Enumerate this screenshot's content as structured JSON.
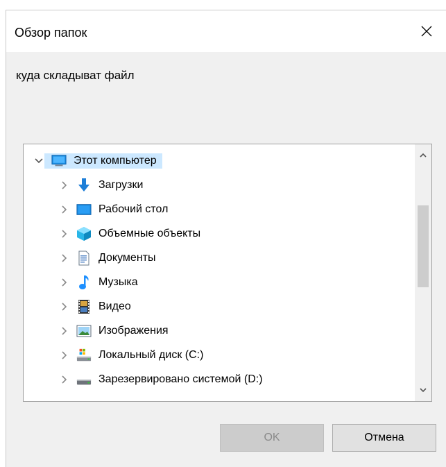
{
  "window": {
    "title": "Обзор папок"
  },
  "prompt": "куда складыват файл",
  "tree": {
    "root": {
      "label": "Этот компьютер",
      "icon": "computer-icon",
      "expanded": true,
      "selected": true
    },
    "items": [
      {
        "label": "Загрузки",
        "icon": "downloads-icon"
      },
      {
        "label": "Рабочий стол",
        "icon": "desktop-icon"
      },
      {
        "label": "Объемные объекты",
        "icon": "3d-objects-icon"
      },
      {
        "label": "Документы",
        "icon": "documents-icon"
      },
      {
        "label": "Музыка",
        "icon": "music-icon"
      },
      {
        "label": "Видео",
        "icon": "video-icon"
      },
      {
        "label": "Изображения",
        "icon": "pictures-icon"
      },
      {
        "label": "Локальный диск (C:)",
        "icon": "local-disk-icon"
      },
      {
        "label": "Зарезервировано системой (D:)",
        "icon": "drive-icon"
      }
    ]
  },
  "buttons": {
    "ok": "OK",
    "cancel": "Отмена"
  },
  "colors": {
    "selection": "#cce8ff",
    "accent": "#1e90ff"
  }
}
